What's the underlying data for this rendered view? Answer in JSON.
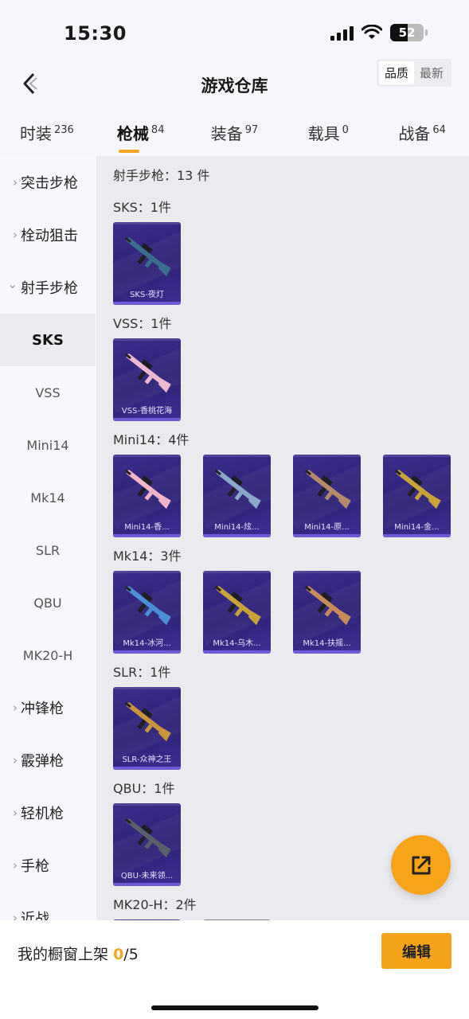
{
  "status_bar": {
    "time": "15:30",
    "battery_percent": "52",
    "battery_level": 0.52
  },
  "header": {
    "title": "游戏仓库",
    "sort_options": [
      "品质",
      "最新"
    ],
    "sort_selected": "品质"
  },
  "tabs": [
    {
      "label": "时装",
      "count": "236"
    },
    {
      "label": "枪械",
      "count": "84",
      "active": true
    },
    {
      "label": "装备",
      "count": "97"
    },
    {
      "label": "载具",
      "count": "0"
    },
    {
      "label": "战备",
      "count": "64"
    }
  ],
  "sidebar": [
    {
      "label": "突击步枪",
      "type": "group",
      "expanded": false
    },
    {
      "label": "栓动狙击",
      "type": "group",
      "expanded": false
    },
    {
      "label": "射手步枪",
      "type": "group",
      "expanded": true
    },
    {
      "label": "SKS",
      "type": "sub",
      "active": true
    },
    {
      "label": "VSS",
      "type": "sub"
    },
    {
      "label": "Mini14",
      "type": "sub"
    },
    {
      "label": "Mk14",
      "type": "sub"
    },
    {
      "label": "SLR",
      "type": "sub"
    },
    {
      "label": "QBU",
      "type": "sub"
    },
    {
      "label": "MK20-H",
      "type": "sub"
    },
    {
      "label": "冲锋枪",
      "type": "group",
      "expanded": false
    },
    {
      "label": "霰弹枪",
      "type": "group",
      "expanded": false
    },
    {
      "label": "轻机枪",
      "type": "group",
      "expanded": false
    },
    {
      "label": "手枪",
      "type": "group",
      "expanded": false
    },
    {
      "label": "近战",
      "type": "group",
      "expanded": false
    }
  ],
  "content": {
    "category_heading": "射手步枪：13 件",
    "sections": [
      {
        "heading": "SKS：1件",
        "items": [
          {
            "name": "SKS-夜灯",
            "tint": "#3a6e8f"
          }
        ]
      },
      {
        "heading": "VSS：1件",
        "items": [
          {
            "name": "VSS-香桃花海",
            "tint": "#f0b8cf"
          }
        ]
      },
      {
        "heading": "Mini14：4件",
        "items": [
          {
            "name": "Mini14-香...",
            "tint": "#f2b5c8"
          },
          {
            "name": "Mini14-炫...",
            "tint": "#8aa7c9"
          },
          {
            "name": "Mini14-原...",
            "tint": "#b48a6a"
          },
          {
            "name": "Mini14-金...",
            "tint": "#c9a23a"
          }
        ]
      },
      {
        "heading": "Mk14：3件",
        "items": [
          {
            "name": "Mk14-冰河...",
            "tint": "#4a8fd6"
          },
          {
            "name": "Mk14-乌木...",
            "tint": "#c9a23a"
          },
          {
            "name": "Mk14-扶摇...",
            "tint": "#c98a5a"
          }
        ]
      },
      {
        "heading": "SLR：1件",
        "items": [
          {
            "name": "SLR-众神之王",
            "tint": "#c9953a"
          }
        ]
      },
      {
        "heading": "QBU：1件",
        "items": [
          {
            "name": "QBU-未来领...",
            "tint": "#5a6068"
          }
        ]
      },
      {
        "heading": "MK20-H：2件",
        "items": []
      }
    ]
  },
  "fab": {
    "icon": "share-external-icon"
  },
  "bottom_bar": {
    "label": "我的橱窗上架",
    "current": "0",
    "total": "/5",
    "edit_label": "编辑"
  },
  "colors": {
    "accent": "#f5a623",
    "card_bg": "#3b2d8c",
    "content_bg": "#e9ebee"
  }
}
